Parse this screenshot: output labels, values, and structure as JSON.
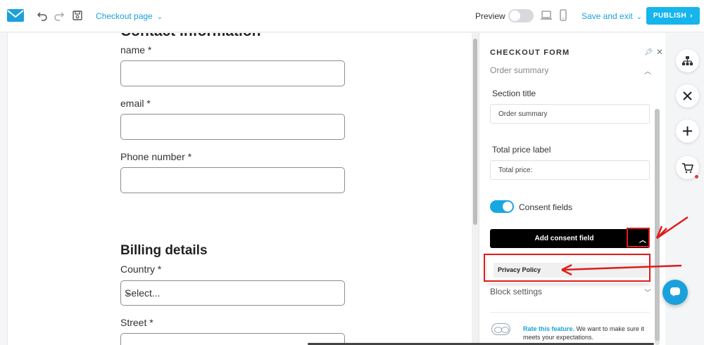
{
  "topbar": {
    "page_selector": "Checkout page",
    "preview_label": "Preview",
    "save_exit_label": "Save and exit",
    "publish_label": "PUBLISH"
  },
  "canvas": {
    "section_title": "Contact information",
    "fields": [
      {
        "label": "name *"
      },
      {
        "label": "email *"
      },
      {
        "label": "Phone number *"
      }
    ],
    "billing_title": "Billing details",
    "country_label": "Country *",
    "country_value": "Select...",
    "street_label": "Street *"
  },
  "panel": {
    "title": "CHECKOUT FORM",
    "subtitle": "Order summary",
    "section_title_label": "Section title",
    "section_title_value": "Order summary",
    "total_price_label": "Total price label",
    "total_price_value": "Total price:",
    "consent_label": "Consent fields",
    "consent_enabled": true,
    "add_consent_label": "Add consent field",
    "dropdown_options": [
      "Privacy Policy"
    ],
    "block_settings_label": "Block settings",
    "rate_link": "Rate this feature.",
    "rate_text": " We want to make sure it meets your expectations."
  },
  "icons": {
    "logo": "envelope-icon",
    "undo": "undo-icon",
    "redo": "redo-icon",
    "save": "save-icon",
    "desktop": "desktop-icon",
    "mobile": "mobile-icon",
    "structure": "sitemap-icon",
    "close": "close-icon",
    "add": "plus-icon",
    "cart": "cart-icon",
    "chat": "chat-icon"
  },
  "colors": {
    "accent": "#16b5ec",
    "link": "#1aa1db",
    "annotation": "#e01b1b"
  }
}
